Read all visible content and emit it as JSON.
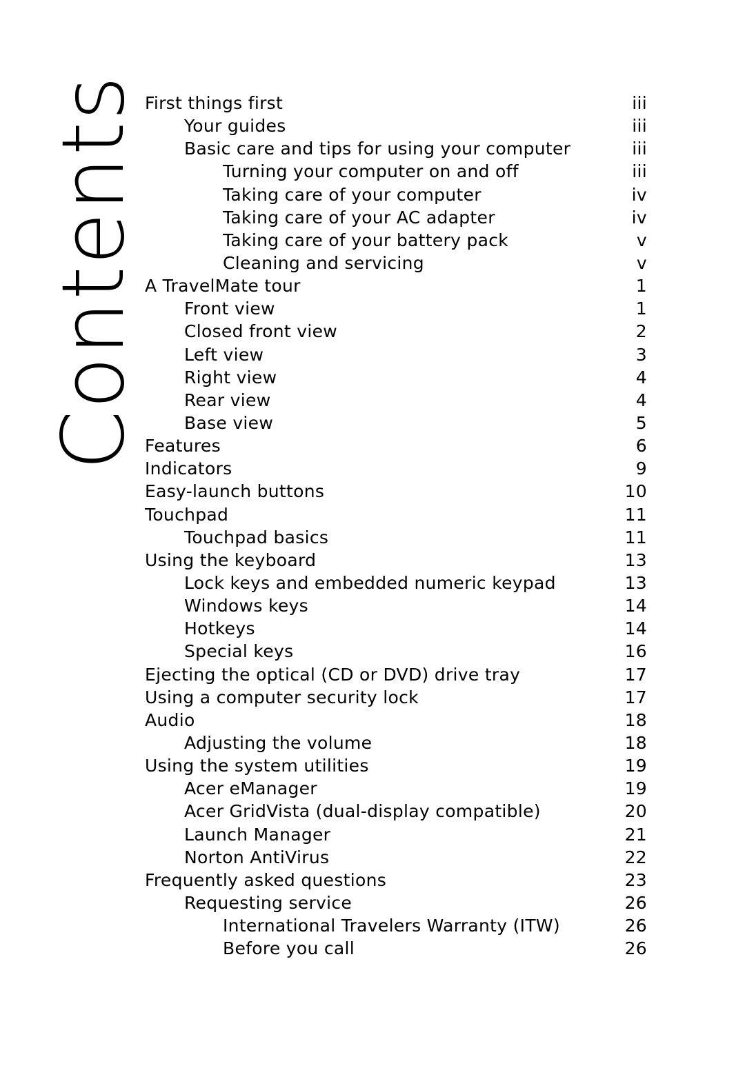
{
  "title": "Contents",
  "entries": [
    {
      "label": "First things first",
      "page": "iii",
      "level": 1
    },
    {
      "label": "Your guides",
      "page": "iii",
      "level": 2
    },
    {
      "label": "Basic care and tips for using your computer",
      "page": "iii",
      "level": 2
    },
    {
      "label": "Turning your computer on and off",
      "page": "iii",
      "level": 3
    },
    {
      "label": "Taking care of your computer",
      "page": "iv",
      "level": 3
    },
    {
      "label": "Taking care of your AC adapter",
      "page": "iv",
      "level": 3
    },
    {
      "label": "Taking care of your battery pack",
      "page": "v",
      "level": 3
    },
    {
      "label": "Cleaning and servicing",
      "page": "v",
      "level": 3
    },
    {
      "label": "A TravelMate tour",
      "page": "1",
      "level": 1
    },
    {
      "label": "Front view",
      "page": "1",
      "level": 2
    },
    {
      "label": "Closed front view",
      "page": "2",
      "level": 2
    },
    {
      "label": "Left view",
      "page": "3",
      "level": 2
    },
    {
      "label": "Right view",
      "page": "4",
      "level": 2
    },
    {
      "label": "Rear view",
      "page": "4",
      "level": 2
    },
    {
      "label": "Base view",
      "page": "5",
      "level": 2
    },
    {
      "label": "Features",
      "page": "6",
      "level": 1
    },
    {
      "label": "Indicators",
      "page": "9",
      "level": 1
    },
    {
      "label": "Easy-launch buttons",
      "page": "10",
      "level": 1
    },
    {
      "label": "Touchpad",
      "page": "11",
      "level": 1
    },
    {
      "label": "Touchpad basics",
      "page": "11",
      "level": 2
    },
    {
      "label": "Using the keyboard",
      "page": "13",
      "level": 1
    },
    {
      "label": "Lock keys and embedded numeric keypad",
      "page": "13",
      "level": 2
    },
    {
      "label": "Windows keys",
      "page": "14",
      "level": 2
    },
    {
      "label": "Hotkeys",
      "page": "14",
      "level": 2
    },
    {
      "label": "Special keys",
      "page": "16",
      "level": 2
    },
    {
      "label": "Ejecting the optical (CD or DVD) drive tray",
      "page": "17",
      "level": 1
    },
    {
      "label": "Using a computer security lock",
      "page": "17",
      "level": 1
    },
    {
      "label": "Audio",
      "page": "18",
      "level": 1
    },
    {
      "label": "Adjusting the volume",
      "page": "18",
      "level": 2
    },
    {
      "label": "Using the system utilities",
      "page": "19",
      "level": 1
    },
    {
      "label": "Acer eManager",
      "page": "19",
      "level": 2
    },
    {
      "label": "Acer GridVista (dual-display compatible)",
      "page": "20",
      "level": 2
    },
    {
      "label": "Launch Manager",
      "page": "21",
      "level": 2
    },
    {
      "label": "Norton AntiVirus",
      "page": "22",
      "level": 2
    },
    {
      "label": "Frequently asked questions",
      "page": "23",
      "level": 1
    },
    {
      "label": "Requesting service",
      "page": "26",
      "level": 2
    },
    {
      "label": "International Travelers Warranty (ITW)",
      "page": "26",
      "level": 3
    },
    {
      "label": "Before you call",
      "page": "26",
      "level": 3
    }
  ]
}
